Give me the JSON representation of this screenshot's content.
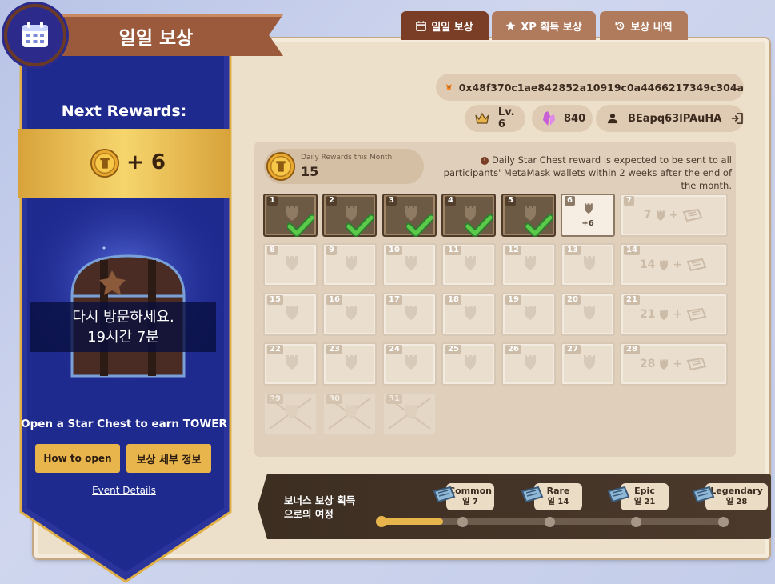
{
  "header": {
    "title": "일일 보상"
  },
  "tabs": [
    {
      "label": "일일 보상",
      "icon": "calendar-icon",
      "active": true
    },
    {
      "label": "XP 획득 보상",
      "icon": "star-icon",
      "active": false
    },
    {
      "label": "보상 내역",
      "icon": "history-icon",
      "active": false
    }
  ],
  "account": {
    "wallet": "0x48f370c1ae842852a10919c0a4466217349c304a",
    "level": "Lv. 6",
    "gems": "840",
    "username": "BEapq63lPAuHA"
  },
  "summary": {
    "label": "Daily Rewards this Month",
    "count": "15",
    "notice": "Daily Star Chest reward is expected to be sent to all participants' MetaMask wallets within 2 weeks after the end of the month."
  },
  "calendar": {
    "claimed": [
      "1",
      "2",
      "3",
      "4",
      "5"
    ],
    "today": {
      "day": "6",
      "reward": "+6"
    },
    "locked": [
      "8",
      "9",
      "10",
      "11",
      "12",
      "13",
      "15",
      "16",
      "17",
      "18",
      "19",
      "20",
      "22",
      "23",
      "24",
      "25",
      "26",
      "27"
    ],
    "bonus": [
      {
        "day": "7",
        "label": "7"
      },
      {
        "day": "14",
        "label": "14"
      },
      {
        "day": "21",
        "label": "21"
      },
      {
        "day": "28",
        "label": "28"
      }
    ],
    "missed": [
      "29",
      "30",
      "31"
    ]
  },
  "journey": {
    "title": "보너스 보상 획득으로의 여정",
    "milestones": [
      {
        "name": "Common",
        "day": "일 7"
      },
      {
        "name": "Rare",
        "day": "일 14"
      },
      {
        "name": "Epic",
        "day": "일 21"
      },
      {
        "name": "Legendary",
        "day": "일 28"
      }
    ],
    "progress": 0.18
  },
  "sidebar": {
    "next_rewards_title": "Next Rewards:",
    "next_rewards_value": "+ 6",
    "revisit_line1": "다시 방문하세요.",
    "revisit_line2": "19시간 7분",
    "earn_text": "Open a Star Chest to earn TOWER",
    "how_to_open": "How to open",
    "reward_details": "보상 세부 정보",
    "event_details": "Event Details"
  },
  "colors": {
    "accent_brown": "#7a3e26",
    "banner_blue": "#1d2a8c",
    "gold": "#e8b54d",
    "parchment": "#ede0cb"
  }
}
